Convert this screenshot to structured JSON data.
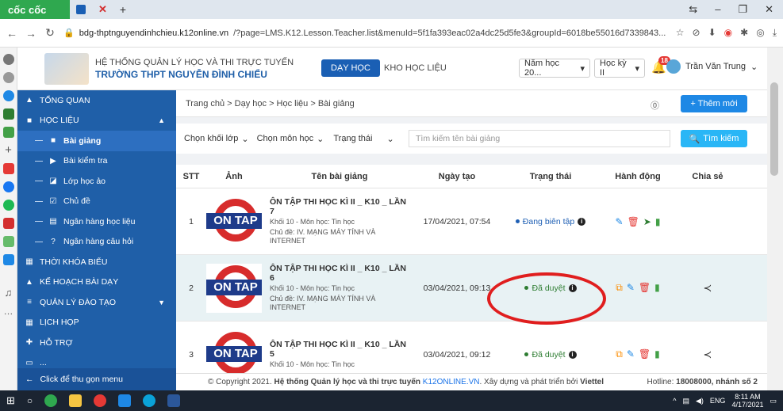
{
  "browser": {
    "name": "cốc cốc",
    "url_domain": "bdg-thptnguyendinhchieu.k12online.vn",
    "url_path": "/?page=LMS.K12.Lesson.Teacher.list&menuId=5f1fa393eac02a4dc25d5fe3&groupId=6018be55016d7339843..."
  },
  "header": {
    "system_name": "HỆ THỐNG QUẢN LÝ HỌC VÀ THI TRỰC TUYẾN",
    "school_name": "TRƯỜNG THPT NGUYỄN ĐÌNH CHIỂU",
    "teaching_btn": "DẠY HỌC",
    "materials_link": "KHO HỌC LIỆU",
    "year_select": "Năm học 20...",
    "term_select": "Học kỳ II",
    "notif_count": "18",
    "user_name": "Trần Văn Trung"
  },
  "sidebar": {
    "items": [
      {
        "label": "TỔNG QUAN",
        "icon": "▲"
      },
      {
        "label": "HỌC LIỆU",
        "icon": "■"
      },
      {
        "label": "Bài giảng",
        "icon": "■"
      },
      {
        "label": "Bài kiểm tra",
        "icon": "▶"
      },
      {
        "label": "Lớp học ảo",
        "icon": "◪"
      },
      {
        "label": "Chủ đề",
        "icon": "☑"
      },
      {
        "label": "Ngân hàng học liệu",
        "icon": "▤"
      },
      {
        "label": "Ngân hàng câu hỏi",
        "icon": "?"
      },
      {
        "label": "THỜI KHÓA BIỂU",
        "icon": "▦"
      },
      {
        "label": "KẾ HOẠCH BÀI DẠY",
        "icon": "▲"
      },
      {
        "label": "QUẢN LÝ ĐÀO TẠO",
        "icon": "≡"
      },
      {
        "label": "LỊCH HỌP",
        "icon": "▦"
      },
      {
        "label": "HỖ TRỢ",
        "icon": "✚"
      },
      {
        "label": "...",
        "icon": "▭"
      }
    ],
    "collapse_label": "Click để thu gọn menu"
  },
  "breadcrumb": "Trang chủ > Dạy học > Học liệu > Bài giảng",
  "add_button": "+ Thêm mới",
  "filters": {
    "grade": "Chọn khối lớp",
    "subject": "Chọn môn học",
    "status": "Trạng thái",
    "search_placeholder": "Tìm kiếm tên bài giảng",
    "search_button": "Tìm kiếm"
  },
  "table": {
    "headers": [
      "STT",
      "Ảnh",
      "Tên bài giảng",
      "Ngày tạo",
      "Trạng thái",
      "Hành động",
      "Chia sẻ"
    ],
    "thumb_text": "ON TAP",
    "rows": [
      {
        "stt": "1",
        "title": "ÔN TẬP THI HỌC KÌ II _ K10 _ LẦN 7",
        "meta1": "Khối 10 - Môn học: Tin học",
        "meta2": "Chủ đề: IV. MẠNG MÁY TÍNH VÀ INTERNET",
        "date": "17/04/2021, 07:54",
        "status": "Đang biên tập",
        "status_color": "#1e5fb4"
      },
      {
        "stt": "2",
        "title": "ÔN TẬP THI HỌC KÌ II _ K10 _ LẦN 6",
        "meta1": "Khối 10 - Môn học: Tin học",
        "meta2": "Chủ đề: IV. MẠNG MÁY TÍNH VÀ INTERNET",
        "date": "03/04/2021, 09:13",
        "status": "Đã duyệt",
        "status_color": "#2e7d32"
      },
      {
        "stt": "3",
        "title": "ÔN TẬP THI HỌC KÌ II _ K10 _ LẦN 5",
        "meta1": "Khối 10 - Môn học: Tin học",
        "meta2": "",
        "date": "03/04/2021, 09:12",
        "status": "Đã duyệt",
        "status_color": "#2e7d32"
      }
    ]
  },
  "footer": {
    "copy": "© Copyright 2021.",
    "system": "Hệ thống Quản lý học và thi trực tuyến",
    "brand": "K12ONLINE.VN",
    "built": ". Xây dựng và phát triển bởi",
    "dev": "Viettel",
    "hotline_label": "Hotline:",
    "hotline": "18008000, nhánh số 2"
  },
  "taskbar": {
    "lang": "ENG",
    "time": "8:11 AM",
    "date": "4/17/2021"
  }
}
